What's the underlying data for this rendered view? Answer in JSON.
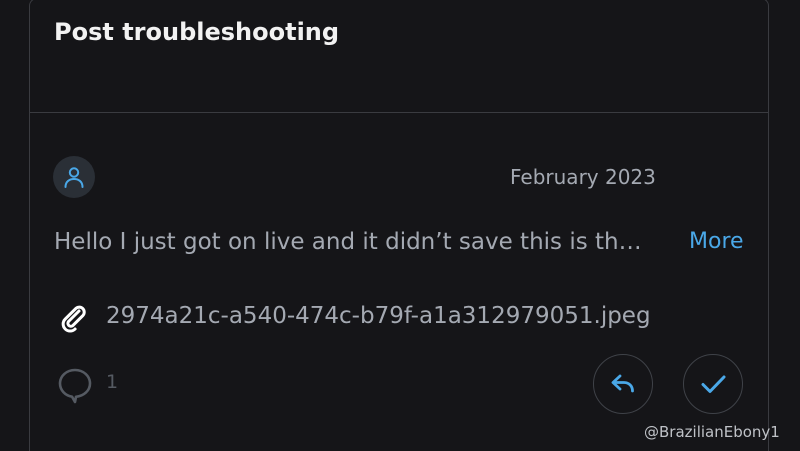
{
  "post": {
    "title": "Post troubleshooting",
    "date": "February 2023",
    "message": "Hello I just got on live and it didn’t save this is th…",
    "more_label": "More",
    "attachment_name": "2974a21c-a540-474c-b79f-a1a312979051.jpeg",
    "comment_count": "1"
  },
  "watermark": "@BrazilianEbony1",
  "icons": {
    "avatar": "user-icon",
    "attachment": "paperclip-icon",
    "comments": "speech-bubble-icon",
    "reply": "reply-arrow-icon",
    "mark_solved": "checkmark-icon"
  },
  "colors": {
    "background": "#151518",
    "accent": "#4aa8e8",
    "text_primary": "#f2f2f2",
    "text_secondary": "#a4a9b2",
    "border": "#3a3b40"
  }
}
